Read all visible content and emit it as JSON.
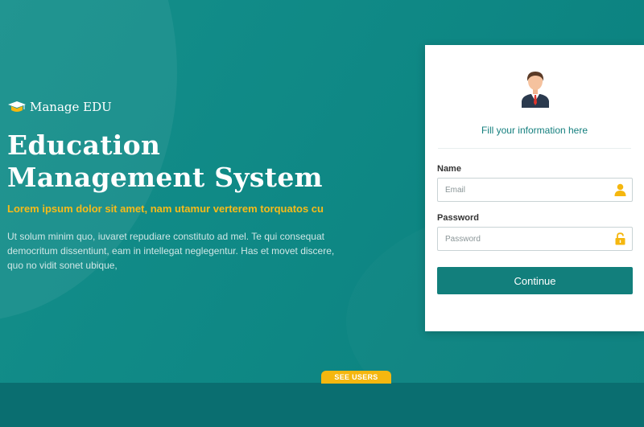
{
  "brand": {
    "name": "Manage EDU",
    "icon": "graduation-cap-icon",
    "icon_color": "#f5b70f"
  },
  "hero": {
    "title_line1": "Education",
    "title_line2": "Management System",
    "subtitle": "Lorem ipsum dolor sit amet, nam utamur verterem torquatos cu",
    "description": "Ut solum minim quo, iuvaret repudiare constituto ad mel. Te qui consequat democritum dissentiunt, eam in intellegat neglegentur. Has et movet discere, quo no vidit sonet ubique,"
  },
  "login": {
    "avatar_icon": "user-avatar-icon",
    "heading": "Fill your information here",
    "name_label": "Name",
    "name_placeholder": "Email",
    "name_icon": "user-icon",
    "password_label": "Password",
    "password_placeholder": "Password",
    "password_icon": "lock-icon",
    "submit_label": "Continue"
  },
  "footer": {
    "see_users_label": "SEE USERS"
  },
  "colors": {
    "background": "#0f8784",
    "accent": "#f5b70f",
    "primary_button": "#127f7c"
  }
}
